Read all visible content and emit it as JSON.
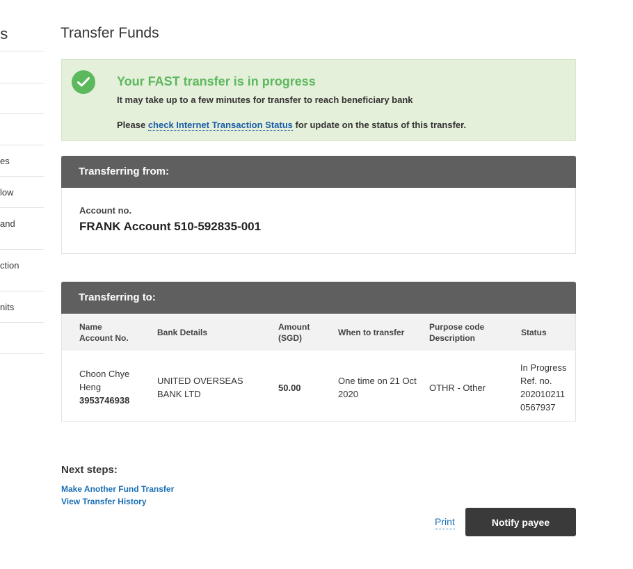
{
  "sidebar": {
    "title": "ds",
    "items": [
      {
        "label": ""
      },
      {
        "label": ""
      },
      {
        "label": ""
      },
      {
        "label": "es"
      },
      {
        "label": "low"
      },
      {
        "label": "and"
      },
      {
        "label": "ction"
      },
      {
        "label": "nits"
      },
      {
        "label": ""
      }
    ]
  },
  "page_title": "Transfer Funds",
  "banner": {
    "icon": "checkmark-circle-icon",
    "color": "#5cb85c",
    "title": "Your FAST transfer is in progress",
    "line1": "It may take up to a few minutes for transfer to reach beneficiary bank",
    "line2_prefix": "Please ",
    "line2_link": "check Internet Transaction Status",
    "line2_suffix": " for update on the status of this transfer."
  },
  "from_panel": {
    "header": "Transferring from:",
    "account_label": "Account no.",
    "account_value": "FRANK Account 510-592835-001"
  },
  "to_panel": {
    "header": "Transferring to:",
    "columns": {
      "name_line1": "Name",
      "name_line2": "Account No.",
      "bank": "Bank Details",
      "amount_line1": "Amount",
      "amount_line2": "(SGD)",
      "when": "When to transfer",
      "purpose_line1": "Purpose code",
      "purpose_line2": "Description",
      "status": "Status"
    },
    "row": {
      "name_line1": "Choon Chye",
      "name_line2": "Heng",
      "account_no": "3953746938",
      "bank_line1": "UNITED OVERSEAS",
      "bank_line2": "BANK LTD",
      "amount": "50.00",
      "when_line1": "One time on 21 Oct",
      "when_line2": "2020",
      "purpose": "OTHR - Other",
      "status_line1": "In Progress",
      "status_line2": "Ref. no.",
      "status_line3": "202010211",
      "status_line4": "0567937"
    }
  },
  "next_steps": {
    "title": "Next steps:",
    "links": [
      "Make Another Fund Transfer",
      "View Transfer History"
    ]
  },
  "actions": {
    "print": "Print",
    "notify": "Notify payee"
  }
}
